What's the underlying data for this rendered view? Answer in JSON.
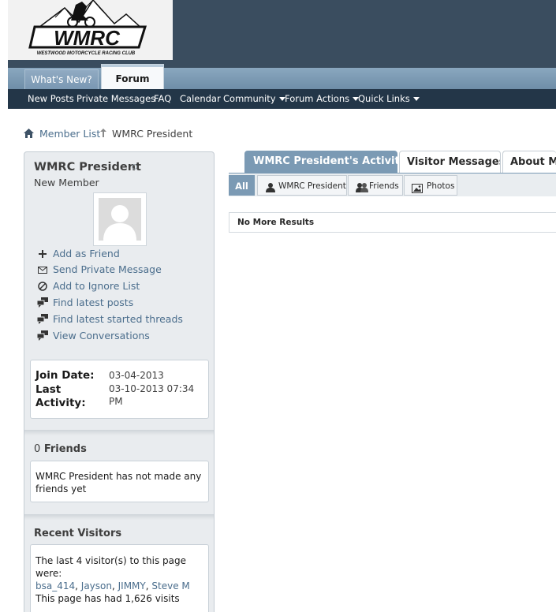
{
  "logo": {
    "text": "WMRC",
    "tagline": "WESTWOOD MOTORCYCLE RACING CLUB"
  },
  "tabs": [
    {
      "label": "What's New?"
    },
    {
      "label": "Forum"
    }
  ],
  "navbar": {
    "items": [
      {
        "label": "New Posts"
      },
      {
        "label": "Private Messages"
      },
      {
        "label": "FAQ"
      },
      {
        "label": "Calendar"
      },
      {
        "label": "Community"
      },
      {
        "label": "Forum Actions"
      },
      {
        "label": "Quick Links"
      }
    ]
  },
  "breadcrumb": {
    "member_list": "Member List",
    "current": "WMRC President"
  },
  "profile": {
    "username": "WMRC President",
    "usertitle": "New Member",
    "actions": [
      {
        "label": "Add as Friend",
        "icon": "plus-icon"
      },
      {
        "label": "Send Private Message",
        "icon": "envelope-icon"
      },
      {
        "label": "Add to Ignore List",
        "icon": "block-icon"
      },
      {
        "label": "Find latest posts",
        "icon": "posts-icon"
      },
      {
        "label": "Find latest started threads",
        "icon": "threads-icon"
      },
      {
        "label": "View Conversations",
        "icon": "conversations-icon"
      }
    ],
    "join_date_label": "Join Date:",
    "join_date": "03-04-2013",
    "last_activity_label_1": "Last",
    "last_activity_label_2": "Activity:",
    "last_activity_1": "03-10-2013 07:34",
    "last_activity_2": "PM"
  },
  "friends": {
    "count": "0",
    "heading": "Friends",
    "text_1": "WMRC President has not made any",
    "text_2": "friends yet"
  },
  "visitors": {
    "heading": "Recent Visitors",
    "text_1": "The last 4 visitor(s) to this page",
    "text_2": "were:",
    "names": [
      "bsa_414",
      "Jayson",
      "JIMMY",
      "Steve M"
    ],
    "visits": "This page has had 1,626 visits"
  },
  "main": {
    "tabs": [
      {
        "label": "WMRC President's Activity"
      },
      {
        "label": "Visitor Messages"
      },
      {
        "label": "About Me"
      }
    ],
    "subtabs": [
      {
        "label": "All"
      },
      {
        "label": "WMRC President"
      },
      {
        "label": "Friends"
      },
      {
        "label": "Photos"
      }
    ],
    "no_results": "No More Results"
  },
  "colors": {
    "header": "#3a4d5f",
    "navbar": "#233648",
    "accent": "#7b9ab4",
    "link": "#4a6d8c"
  }
}
